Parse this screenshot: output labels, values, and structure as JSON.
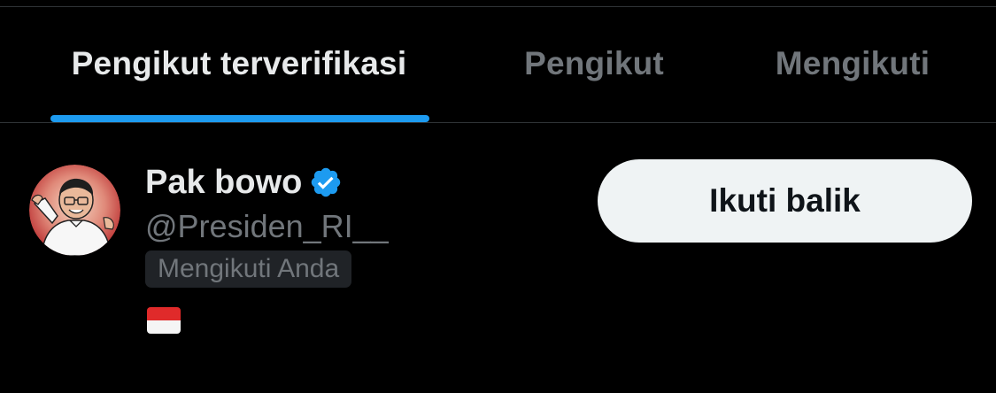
{
  "tabs": [
    {
      "label": "Pengikut terverifikasi",
      "active": true
    },
    {
      "label": "Pengikut",
      "active": false
    },
    {
      "label": "Mengikuti",
      "active": false
    }
  ],
  "user": {
    "display_name": "Pak bowo",
    "handle": "@Presiden_RI__",
    "follows_you_label": "Mengikuti Anda",
    "verified": true,
    "bio_icon": "indonesia-flag-icon",
    "avatar_icon": "profile-caricature-avatar"
  },
  "follow_back_button": {
    "label": "Ikuti balik"
  },
  "colors": {
    "background": "#000000",
    "accent": "#1d9bf0",
    "primary_text": "#e7e9ea",
    "secondary_text": "#71767b",
    "button_bg": "#eff3f4",
    "button_text": "#0f1419"
  }
}
